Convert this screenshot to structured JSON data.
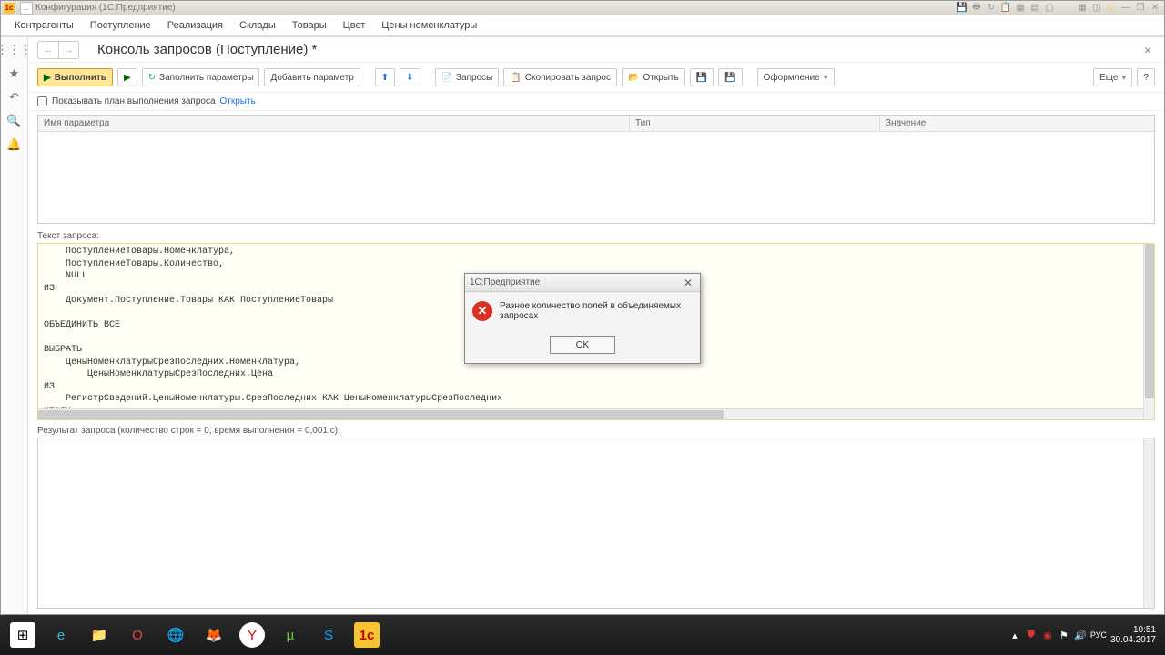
{
  "titlebar": {
    "title": "Конфигурация (1С:Предприятие)"
  },
  "menu": [
    "Контрагенты",
    "Поступление",
    "Реализация",
    "Склады",
    "Товары",
    "Цвет",
    "Цены номенклатуры"
  ],
  "page": {
    "title": "Консоль запросов (Поступление) *",
    "toolbar": {
      "execute": "Выполнить",
      "fill_params": "Заполнить параметры",
      "add_param": "Добавить параметр",
      "queries": "Запросы",
      "copy_query": "Скопировать запрос",
      "open": "Открыть",
      "format": "Оформление",
      "more": "Еще"
    },
    "check": {
      "label": "Показывать план выполнения запроса",
      "link": "Открыть"
    },
    "params_headers": {
      "name": "Имя параметра",
      "type": "Тип",
      "value": "Значение"
    },
    "query_label": "Текст запроса:",
    "query_text": "    ПоступлениеТовары.Номенклатура,\n    ПоступлениеТовары.Количество,\n    NULL\nИЗ\n    Документ.Поступление.Товары КАК ПоступлениеТовары\n\nОБЪЕДИНИТЬ ВСЕ\n\nВЫБРАТЬ\n    ЦеныНоменклатурыСрезПоследних.Номенклатура,\n        ЦеныНоменклатурыСрезПоследних.Цена\nИЗ\n    РегистрСведений.ЦеныНоменклатуры.СрезПоследних КАК ЦеныНоменклатурыСрезПоследних\nИТОГИ\n    СУММА(Количество)\nПО\n    Номенклатура",
    "result_label": "Результат запроса (количество строк = 0, время выполнения = 0,001 c):"
  },
  "dialog": {
    "title": "1С:Предприятие",
    "message": "Разное количество полей в объединяемых запросах",
    "ok": "OK"
  },
  "tray": {
    "lang": "РУС",
    "time": "10:51",
    "date": "30.04.2017"
  },
  "colors": {
    "accent": "#ffe699"
  }
}
